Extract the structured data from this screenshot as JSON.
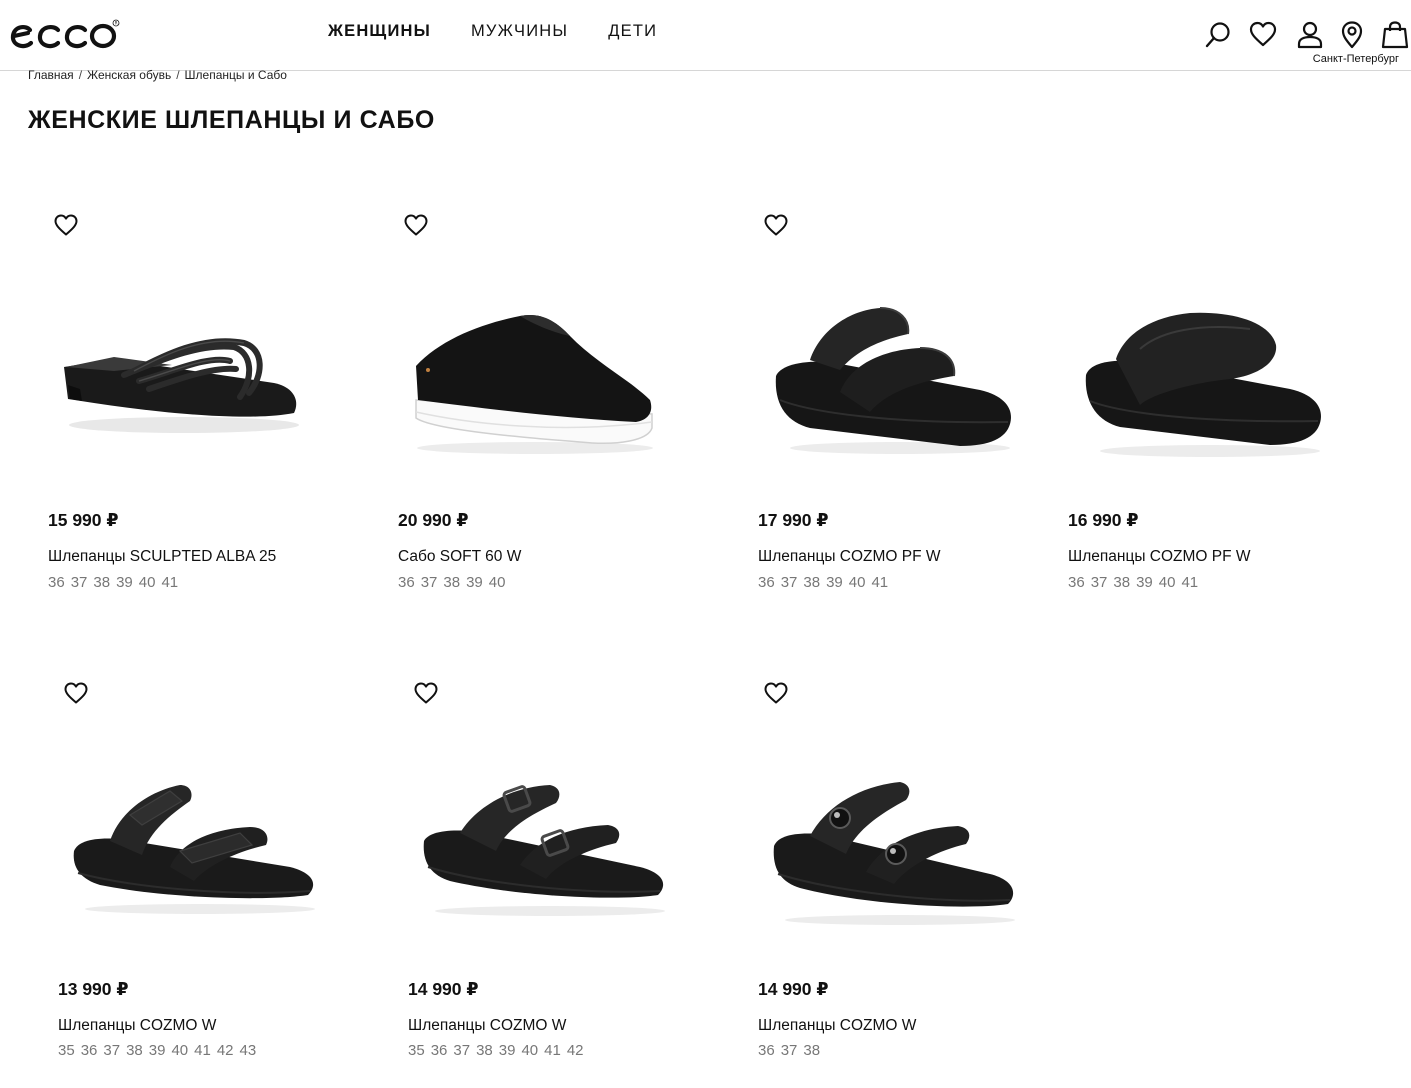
{
  "header": {
    "logo_text": "ecco",
    "nav": [
      "ЖЕНЩИНЫ",
      "МУЖЧИНЫ",
      "ДЕТИ"
    ],
    "icons": [
      "search-icon",
      "heart-icon",
      "user-icon",
      "location-pin-icon",
      "shopping-bag-icon"
    ],
    "city": "Санкт-Петербург"
  },
  "breadcrumb": [
    "Главная",
    "Женская обувь",
    "Шлепанцы и Сабо"
  ],
  "page_title": "ЖЕНСКИЕ ШЛЕПАНЦЫ И САБО",
  "products": [
    {
      "price": "15 990 ₽",
      "name": "Шлепанцы SCULPTED ALBA 25",
      "sizes": [
        "36",
        "37",
        "38",
        "39",
        "40",
        "41"
      ],
      "image": "black-woven-strap-slide"
    },
    {
      "price": "20 990 ₽",
      "name": "Сабо SOFT 60 W",
      "sizes": [
        "36",
        "37",
        "38",
        "39",
        "40"
      ],
      "image": "black-leather-clog-white-sole"
    },
    {
      "price": "17 990 ₽",
      "name": "Шлепанцы COZMO PF W",
      "sizes": [
        "36",
        "37",
        "38",
        "39",
        "40",
        "41"
      ],
      "image": "black-two-strap-platform-slide"
    },
    {
      "price": "16 990 ₽",
      "name": "Шлепанцы COZMO PF W",
      "sizes": [
        "36",
        "37",
        "38",
        "39",
        "40",
        "41"
      ],
      "image": "black-single-strap-platform-slide"
    },
    {
      "price": "13 990 ₽",
      "name": "Шлепанцы COZMO W",
      "sizes": [
        "35",
        "36",
        "37",
        "38",
        "39",
        "40",
        "41",
        "42",
        "43"
      ],
      "image": "black-two-velcro-strap-slide"
    },
    {
      "price": "14 990 ₽",
      "name": "Шлепанцы COZMO W",
      "sizes": [
        "35",
        "36",
        "37",
        "38",
        "39",
        "40",
        "41",
        "42"
      ],
      "image": "black-two-buckle-strap-slide"
    },
    {
      "price": "14 990 ₽",
      "name": "Шлепанцы COZMO W",
      "sizes": [
        "36",
        "37",
        "38"
      ],
      "image": "black-two-stud-strap-slide"
    }
  ]
}
